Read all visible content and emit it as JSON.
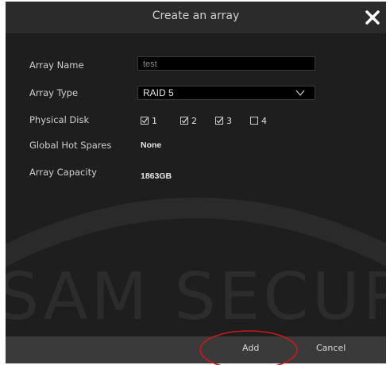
{
  "dialog": {
    "title": "Create an array",
    "close_icon": "close-icon"
  },
  "form": {
    "array_name": {
      "label": "Array Name",
      "value": "test"
    },
    "array_type": {
      "label": "Array Type",
      "value": "RAID 5",
      "icon": "chevron-down-icon"
    },
    "physical_disk": {
      "label": "Physical Disk",
      "disks": [
        {
          "label": "1",
          "checked": true
        },
        {
          "label": "2",
          "checked": true
        },
        {
          "label": "3",
          "checked": true
        },
        {
          "label": "4",
          "checked": false
        }
      ]
    },
    "global_hot_spares": {
      "label": "Global Hot Spares",
      "value": "None"
    },
    "array_capacity": {
      "label": "Array Capacity",
      "value": "1863GB"
    }
  },
  "footer": {
    "add_label": "Add",
    "cancel_label": "Cancel"
  },
  "colors": {
    "dialog_bg": "#1e1e1e",
    "titlebar_bg": "#2b2b2b",
    "footer_bg": "#3a3a3a",
    "highlight_circle": "#d01818"
  }
}
